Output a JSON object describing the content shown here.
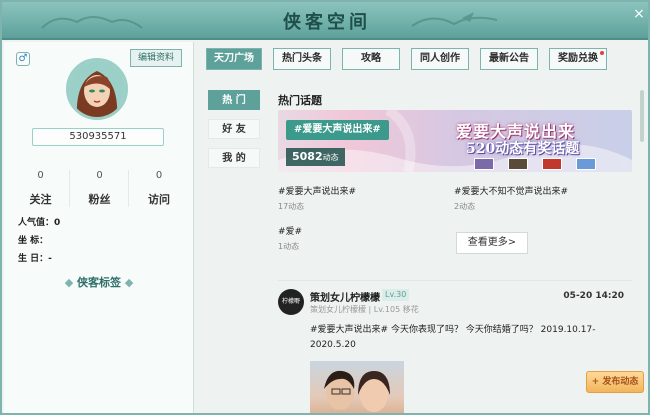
{
  "window": {
    "title": "侠客空间",
    "close_symbol": "×"
  },
  "profile": {
    "gender_symbol": "♂",
    "edit_label": "编辑资料",
    "user_id": "530935571",
    "stats": [
      {
        "value": "0",
        "label": "关注"
      },
      {
        "value": "0",
        "label": "粉丝"
      },
      {
        "value": "0",
        "label": "访问"
      }
    ],
    "popularity_label": "人气值：",
    "popularity_value": "0",
    "coords_label": "坐  标：",
    "birthday_label": "生  日：",
    "birthday_value": "-",
    "tags_title": "侠客标签"
  },
  "nav": {
    "tabs": [
      {
        "label": "天刀广场",
        "active": true
      },
      {
        "label": "热门头条",
        "active": false
      },
      {
        "label": "攻略",
        "active": false
      },
      {
        "label": "同人创作",
        "active": false
      },
      {
        "label": "最新公告",
        "active": false
      },
      {
        "label": "奖励兑换",
        "active": false
      }
    ]
  },
  "subnav": {
    "items": [
      "热 门",
      "好 友",
      "我 的"
    ]
  },
  "hot_topics": {
    "title": "热门话题",
    "banner": {
      "tag": "#爱要大声说出来#",
      "count_value": "5082",
      "count_unit": "动态",
      "headline1": "爱要大声说出来",
      "headline2": "520动态有奖话题"
    },
    "topics": [
      {
        "title": "#爱要大声说出来#",
        "count": "17动态"
      },
      {
        "title": "#爱要大不知不觉声说出来#",
        "count": "2动态"
      },
      {
        "title": "#爱#",
        "count": "1动态"
      }
    ],
    "more_label": "查看更多>"
  },
  "post": {
    "avatar_text": "柠檬嘢",
    "author": "策划女儿柠檬檬",
    "level": "Lv.30",
    "subtitle": "策划女儿柠檬檬 | Lv.105 移花",
    "time": "05-20 14:20",
    "content": "#爱要大声说出来# 今天你表现了吗？ 今天你结婚了吗？ 2019.10.17-2020.5.20"
  },
  "publish_label": "+ 发布动态",
  "colors": {
    "accent": "#5ea19a",
    "title_bar": "#6fb0a9",
    "publish": "#f2b55a"
  }
}
